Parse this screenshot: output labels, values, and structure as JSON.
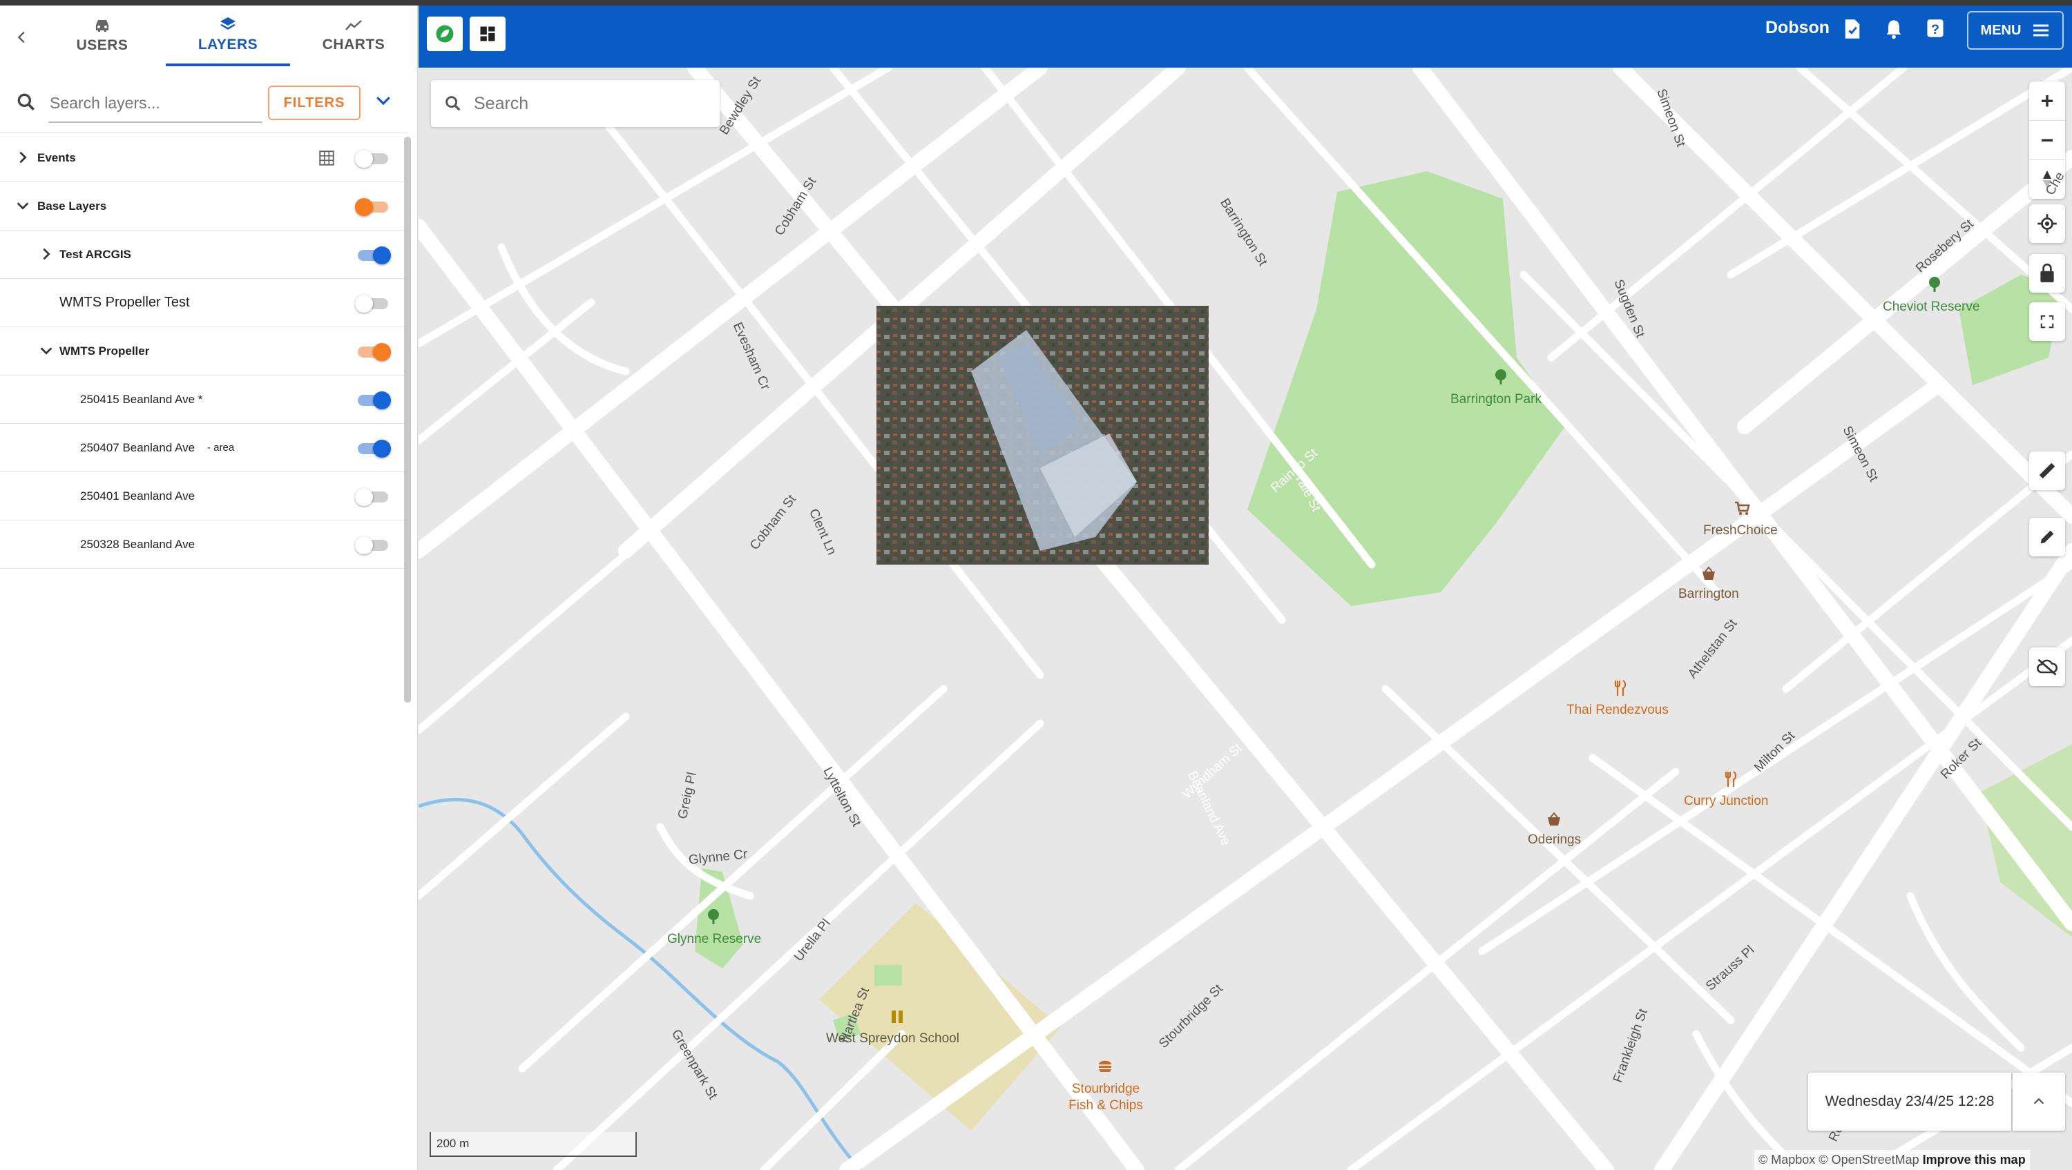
{
  "tabs": [
    {
      "label": "USERS",
      "icon": "car-icon"
    },
    {
      "label": "LAYERS",
      "icon": "layers-icon",
      "active": true
    },
    {
      "label": "CHARTS",
      "icon": "chart-line-icon"
    }
  ],
  "layer_search": {
    "placeholder": "Search layers...",
    "filters_label": "FILTERS"
  },
  "layers": [
    {
      "label": "Events",
      "state": "off"
    },
    {
      "label": "Base Layers",
      "state": "partial"
    },
    {
      "label": "Test ARCGIS",
      "state": "on"
    },
    {
      "label": "WMTS Propeller Test",
      "state": "off"
    },
    {
      "label": "WMTS Propeller",
      "state": "partial-on"
    },
    {
      "label": "250415 Beanland Ave *",
      "state": "on"
    },
    {
      "label": "250407 Beanland Ave",
      "suffix": "- area",
      "state": "on"
    },
    {
      "label": "250401 Beanland Ave",
      "state": "off"
    },
    {
      "label": "250328 Beanland Ave",
      "state": "off"
    }
  ],
  "header": {
    "user": "Dobson",
    "menu_label": "MENU",
    "accent": "#0a5cc5"
  },
  "map": {
    "search_placeholder": "Search",
    "scale_label": "200 m",
    "datetime": "Wednesday 23/4/25 12:28",
    "attribution": "© Mapbox © OpenStreetMap",
    "improve": "Improve this map",
    "pois": {
      "barrington_park": "Barrington Park",
      "cheviot_reserve": "Cheviot Reserve",
      "freshchoice": "FreshChoice",
      "barrington": "Barrington",
      "thai": "Thai Rendezvous",
      "curry": "Curry Junction",
      "oderings": "Oderings",
      "glynne_reserve": "Glynne Reserve",
      "west_spreydon": "West Spreydon School",
      "stourbridge_fish": "Stourbridge Fish & Chips"
    },
    "streets": {
      "bewdley": "Bewdley St",
      "cobham1": "Cobham St",
      "cobham2": "Cobham St",
      "barrington_st": "Barrington St",
      "sugden": "Sugden St",
      "rosebery": "Rosebery St",
      "simeon": "Simeon St",
      "evesham": "Evesham Cr",
      "clent": "Clent Ln",
      "athelstan": "Athelstan St",
      "milton": "Milton St",
      "roker": "Roker St",
      "lyttelton": "Lyttelton St",
      "greig": "Greig Pl",
      "glynne_cr": "Glynne Cr",
      "urella": "Urella Pl",
      "greenpark": "Greenpark St",
      "stourbridge": "Stourbridge St",
      "frankleigh": "Frankleigh St",
      "strauss": "Strauss Pl",
      "roberta": "Roberta Dr",
      "beanland": "Beanland Ave",
      "wyndham": "Wyndham St",
      "rainer": "Raineo St",
      "yale": "Yale St",
      "hartlea": "Hartlea St",
      "simeon_top": "Simeon St",
      "cheviot_rd": "Che"
    }
  }
}
